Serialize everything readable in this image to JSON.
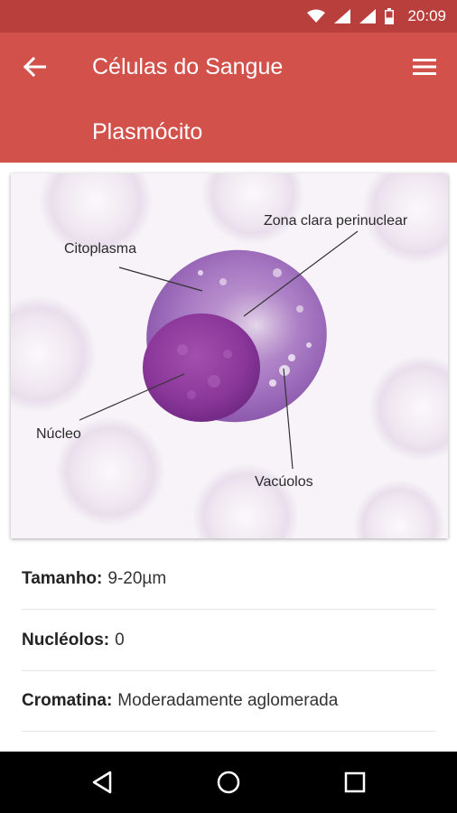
{
  "status_bar": {
    "time": "20:09"
  },
  "header": {
    "title": "Células do Sangue",
    "subtitle": "Plasmócito"
  },
  "figure": {
    "labels": {
      "citoplasma": "Citoplasma",
      "zona_clara": "Zona clara perinuclear",
      "nucleo": "Núcleo",
      "vacuolos": "Vacúolos"
    }
  },
  "details": [
    {
      "label": "Tamanho:",
      "value": "9-20µm"
    },
    {
      "label": "Nucléolos:",
      "value": "0"
    },
    {
      "label": "Cromatina:",
      "value": "Moderadamente aglomerada"
    }
  ],
  "colors": {
    "status": "#b83f3b",
    "appbar": "#d2514b",
    "navbar": "#000000"
  }
}
